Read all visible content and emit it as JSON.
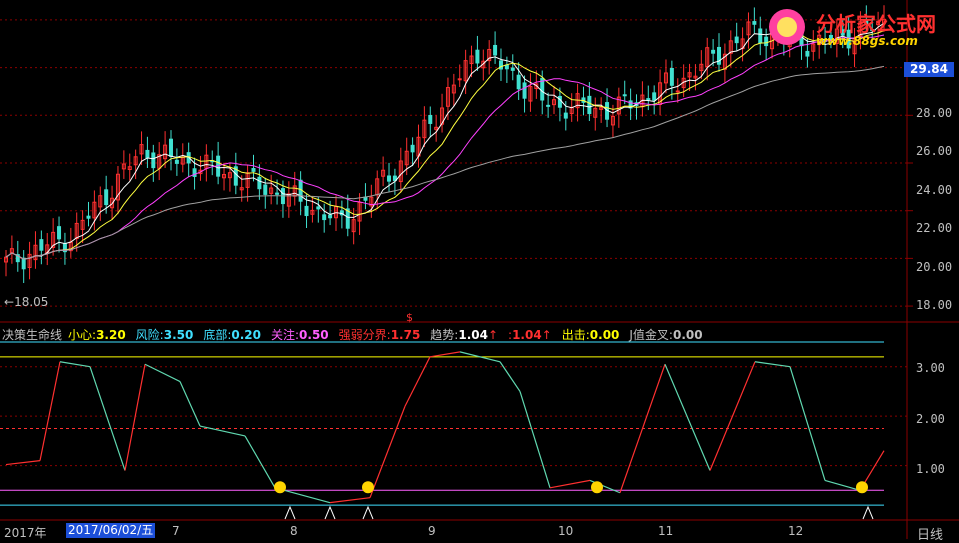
{
  "watermark": {
    "brand": "分析家公式网",
    "url": "www.88gs.com"
  },
  "price_axis": {
    "ticks": [
      "28.00",
      "26.00",
      "24.00",
      "22.00",
      "20.00",
      "18.00"
    ],
    "current_price": "29.84",
    "low_marker": "18.05"
  },
  "indicator_axis": {
    "ticks": [
      "3.00",
      "2.00",
      "1.00"
    ]
  },
  "indicator_header": {
    "name": "决策生命线",
    "items": [
      {
        "label": "小心:",
        "value": "3.20",
        "label_color": "#ffff00",
        "value_color": "#ffff00"
      },
      {
        "label": "风险:",
        "value": "3.50",
        "label_color": "#40e0ff",
        "value_color": "#40e0ff"
      },
      {
        "label": "底部:",
        "value": "0.20",
        "label_color": "#40e0ff",
        "value_color": "#40e0ff"
      },
      {
        "label": "关注:",
        "value": "0.50",
        "label_color": "#ff60ff",
        "value_color": "#ff60ff"
      },
      {
        "label": "强弱分界:",
        "value": "1.75",
        "label_color": "#ff3030",
        "value_color": "#ff3030"
      },
      {
        "label": "趋势:",
        "value": "1.04",
        "arrow": "↑",
        "label_color": "#c0c0c0",
        "value_color": "#ffffff"
      },
      {
        "label": ":",
        "value": "1.04",
        "arrow": "↑",
        "label_color": "#ff3030",
        "value_color": "#ff3030"
      },
      {
        "label": "出击:",
        "value": "0.00",
        "label_color": "#ffff00",
        "value_color": "#ffff00"
      },
      {
        "label": "J值金叉:",
        "value": "0.00",
        "label_color": "#c0c0c0",
        "value_color": "#c0c0c0"
      }
    ],
    "marker": "$"
  },
  "x_axis": {
    "year_label": "2017年",
    "selected_date": "2017/06/02/五",
    "months": [
      "7",
      "8",
      "9",
      "10",
      "11",
      "12"
    ],
    "period": "日线"
  },
  "colors": {
    "up": "#ff3030",
    "down": "#40e0d0",
    "ma5": "#ffffff",
    "ma10": "#ffff40",
    "ma20": "#ff40ff",
    "ma60": "#a0a0a0",
    "accent": "#1c4fd8"
  },
  "chart_data": {
    "type": "line",
    "title": "",
    "xlabel": "",
    "ylabel": "",
    "candles_estimated": {
      "x": [
        "2017-06",
        "2017-06",
        "2017-07",
        "2017-07",
        "2017-08",
        "2017-08",
        "2017-09",
        "2017-09",
        "2017-10",
        "2017-10",
        "2017-11",
        "2017-11",
        "2017-12",
        "2017-12"
      ],
      "close": [
        19.8,
        21.0,
        24.5,
        23.8,
        22.8,
        21.5,
        24.5,
        28.8,
        26.5,
        26.2,
        27.5,
        29.5,
        29.0,
        29.84
      ]
    },
    "price_ylim": [
      17.5,
      30.5
    ],
    "indicator_ylim": [
      0.0,
      3.5
    ],
    "indicator_levels": {
      "小心": 3.2,
      "风险": 3.5,
      "底部": 0.2,
      "关注": 0.5,
      "强弱分界": 1.75
    }
  }
}
